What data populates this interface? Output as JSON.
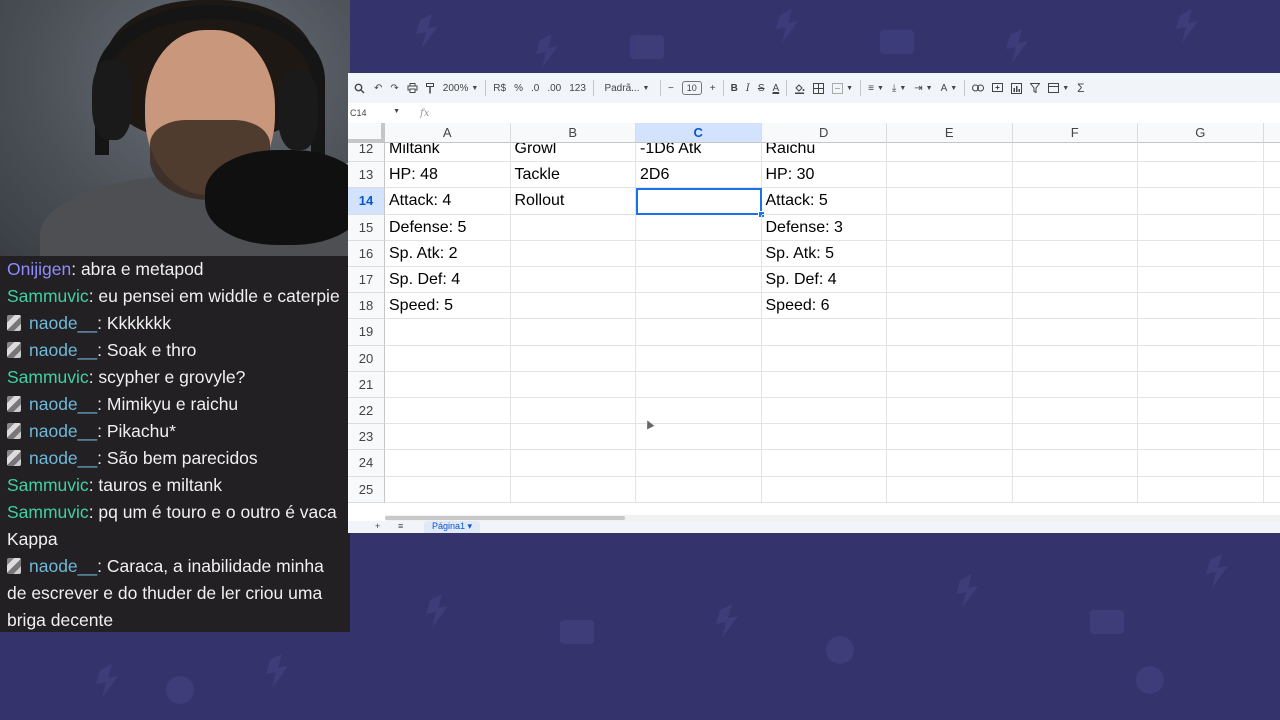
{
  "chat": {
    "messages": [
      {
        "user": "Onijigen",
        "color": "#8e8cff",
        "badge": false,
        "text": "abra e metapod"
      },
      {
        "user": "Sammuvic",
        "color": "#3fd1a0",
        "badge": false,
        "text": "eu pensei em widdle e caterpie"
      },
      {
        "user": "naode__",
        "color": "#6fb8d8",
        "badge": true,
        "text": "Kkkkkkk"
      },
      {
        "user": "naode__",
        "color": "#6fb8d8",
        "badge": true,
        "text": "Soak e thro"
      },
      {
        "user": "Sammuvic",
        "color": "#3fd1a0",
        "badge": false,
        "text": "scypher e grovyle?"
      },
      {
        "user": "naode__",
        "color": "#6fb8d8",
        "badge": true,
        "text": "Mimikyu e raichu"
      },
      {
        "user": "naode__",
        "color": "#6fb8d8",
        "badge": true,
        "text": "Pikachu*"
      },
      {
        "user": "naode__",
        "color": "#6fb8d8",
        "badge": true,
        "text": "São bem parecidos"
      },
      {
        "user": "Sammuvic",
        "color": "#3fd1a0",
        "badge": false,
        "text": "tauros e miltank"
      },
      {
        "user": "Sammuvic",
        "color": "#3fd1a0",
        "badge": false,
        "text": "pq um é touro e o outro é vaca Kappa"
      },
      {
        "user": "naode__",
        "color": "#6fb8d8",
        "badge": true,
        "text": "Caraca, a inabilidade minha de escrever e do thuder de ler criou uma briga decente"
      }
    ]
  },
  "toolbar": {
    "zoom": "200%",
    "currency": "R$",
    "percent": "%",
    "dec_decrease": ".0",
    "dec_increase": ".00",
    "number_format": "123",
    "font": "Padrã...",
    "font_size": "10",
    "bold": "B",
    "italic": "I",
    "strike": "S",
    "text_color": "A",
    "function": "Σ"
  },
  "formula": {
    "namebox": "C14",
    "fx": "fx"
  },
  "columns": [
    "A",
    "B",
    "C",
    "D",
    "E",
    "F",
    "G"
  ],
  "selected_column": "C",
  "selected_row": "14",
  "rows": [
    {
      "num": "12",
      "cells": [
        "Miltank",
        "Growl",
        "-1D6 Atk",
        "Raichu",
        "",
        "",
        ""
      ]
    },
    {
      "num": "13",
      "cells": [
        "HP: 48",
        "Tackle",
        "2D6",
        "HP: 30",
        "",
        "",
        ""
      ]
    },
    {
      "num": "14",
      "cells": [
        "Attack: 4",
        "Rollout",
        "",
        "Attack: 5",
        "",
        "",
        ""
      ]
    },
    {
      "num": "15",
      "cells": [
        "Defense: 5",
        "",
        "",
        "Defense: 3",
        "",
        "",
        ""
      ]
    },
    {
      "num": "16",
      "cells": [
        "Sp. Atk: 2",
        "",
        "",
        "Sp. Atk: 5",
        "",
        "",
        ""
      ]
    },
    {
      "num": "17",
      "cells": [
        "Sp. Def: 4",
        "",
        "",
        "Sp. Def: 4",
        "",
        "",
        ""
      ]
    },
    {
      "num": "18",
      "cells": [
        "Speed: 5",
        "",
        "",
        "Speed: 6",
        "",
        "",
        ""
      ]
    },
    {
      "num": "19",
      "cells": [
        "",
        "",
        "",
        "",
        "",
        "",
        ""
      ]
    },
    {
      "num": "20",
      "cells": [
        "",
        "",
        "",
        "",
        "",
        "",
        ""
      ]
    },
    {
      "num": "21",
      "cells": [
        "",
        "",
        "",
        "",
        "",
        "",
        ""
      ]
    },
    {
      "num": "22",
      "cells": [
        "",
        "",
        "",
        "",
        "",
        "",
        ""
      ]
    },
    {
      "num": "23",
      "cells": [
        "",
        "",
        "",
        "",
        "",
        "",
        ""
      ]
    },
    {
      "num": "24",
      "cells": [
        "",
        "",
        "",
        "",
        "",
        "",
        ""
      ]
    },
    {
      "num": "25",
      "cells": [
        "",
        "",
        "",
        "",
        "",
        "",
        ""
      ]
    }
  ],
  "sheet_tab": "Página1",
  "colors": {
    "background": "#34336b",
    "chat_bg": "#222022",
    "selection": "#1a73e8"
  }
}
